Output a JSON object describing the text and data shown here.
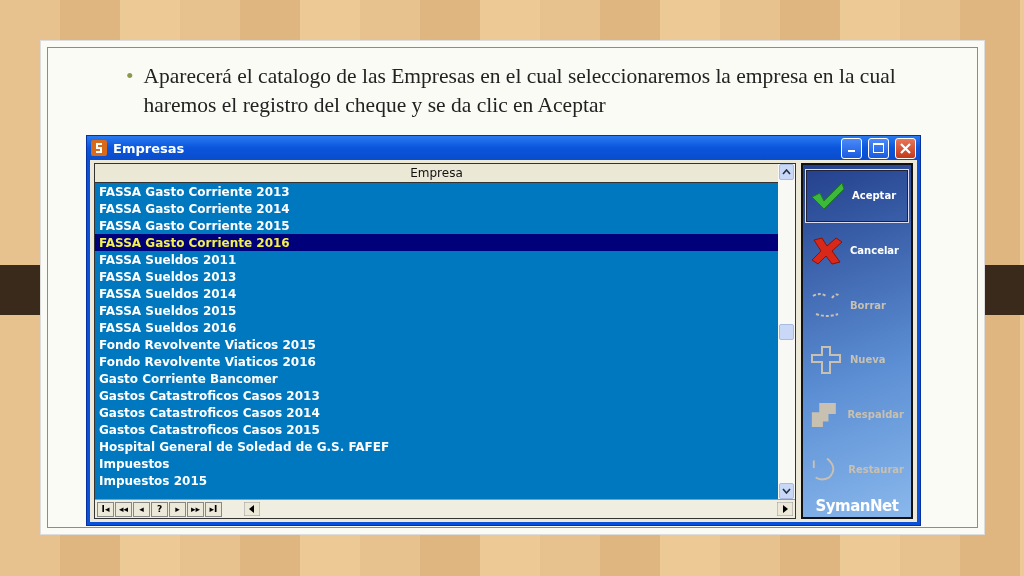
{
  "slide": {
    "bullet": "•",
    "text": "Aparecerá el catalogo de las Empresas en el cual seleccionaremos la empresa en la cual haremos el registro del cheque y se da clic en Aceptar"
  },
  "window": {
    "title": "Empresas"
  },
  "table": {
    "columns": [
      "Empresa"
    ],
    "rows": [
      {
        "name": "FASSA Gasto Corriente 2013",
        "selected": false
      },
      {
        "name": "FASSA Gasto Corriente 2014",
        "selected": false
      },
      {
        "name": "FASSA Gasto Corriente 2015",
        "selected": false
      },
      {
        "name": "FASSA Gasto Corriente 2016",
        "selected": true
      },
      {
        "name": "FASSA Sueldos 2011",
        "selected": false
      },
      {
        "name": "FASSA Sueldos 2013",
        "selected": false
      },
      {
        "name": "FASSA Sueldos 2014",
        "selected": false
      },
      {
        "name": "FASSA Sueldos 2015",
        "selected": false
      },
      {
        "name": "FASSA Sueldos 2016",
        "selected": false
      },
      {
        "name": "Fondo Revolvente Viaticos 2015",
        "selected": false
      },
      {
        "name": "Fondo Revolvente Viaticos 2016",
        "selected": false
      },
      {
        "name": "Gasto Corriente Bancomer",
        "selected": false
      },
      {
        "name": "Gastos Catastroficos Casos 2013",
        "selected": false
      },
      {
        "name": "Gastos Catastroficos Casos 2014",
        "selected": false
      },
      {
        "name": "Gastos Catastroficos Casos 2015",
        "selected": false
      },
      {
        "name": "Hospital General de Soledad de G.S. FAFEF",
        "selected": false
      },
      {
        "name": "Impuestos",
        "selected": false
      },
      {
        "name": "Impuestos 2015",
        "selected": false
      }
    ]
  },
  "navigator": [
    "I◂",
    "◂◂",
    "◂",
    "?",
    "▸",
    "▸▸",
    "▸I"
  ],
  "side_buttons": [
    {
      "kind": "check",
      "label": "Aceptar",
      "selected": true,
      "disabled": false
    },
    {
      "kind": "cross",
      "label": "Cancelar",
      "selected": false,
      "disabled": false
    },
    {
      "kind": "erase",
      "label": "Borrar",
      "selected": false,
      "disabled": true
    },
    {
      "kind": "new",
      "label": "Nueva",
      "selected": false,
      "disabled": true
    },
    {
      "kind": "backup",
      "label": "Respaldar",
      "selected": false,
      "disabled": true
    },
    {
      "kind": "restore",
      "label": "Restaurar",
      "selected": false,
      "disabled": true
    }
  ],
  "logo": "SymanNet"
}
